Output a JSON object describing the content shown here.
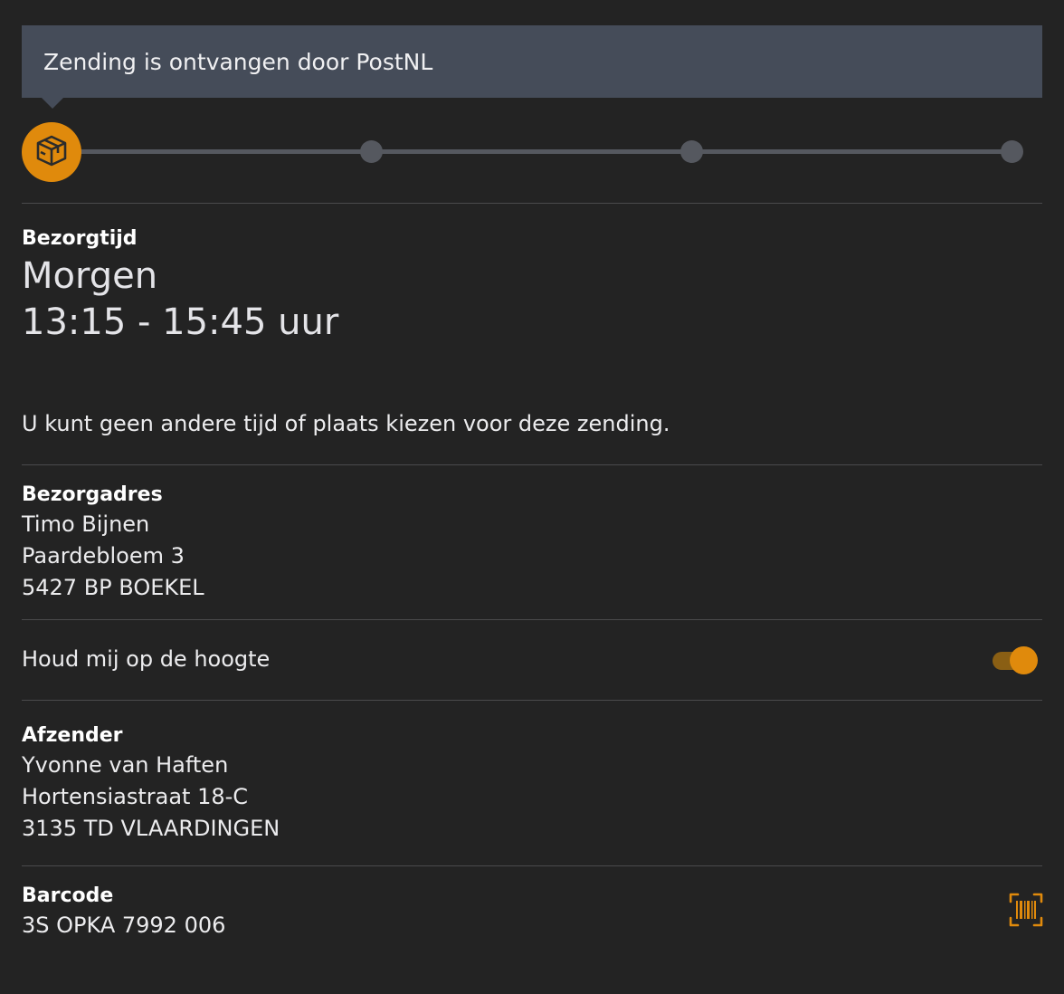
{
  "status": {
    "message": "Zending is ontvangen door PostNL"
  },
  "tracker": {
    "steps_total": 4,
    "current_step": 1,
    "current_icon": "package-icon",
    "accent_color": "#e08a0c"
  },
  "delivery_time": {
    "label": "Bezorgtijd",
    "day": "Morgen",
    "window": "13:15 - 15:45 uur",
    "note": "U kunt geen andere tijd of plaats kiezen voor deze zending."
  },
  "delivery_address": {
    "label": "Bezorgadres",
    "name": "Timo Bijnen",
    "street": "Paardebloem 3",
    "city": "5427 BP BOEKEL"
  },
  "notifications": {
    "label": "Houd mij op de hoogte",
    "enabled": true
  },
  "sender": {
    "label": "Afzender",
    "name": "Yvonne van Haften",
    "street": "Hortensiastraat 18-C",
    "city": "3135 TD VLAARDINGEN"
  },
  "barcode": {
    "label": "Barcode",
    "value": "3S OPKA 7992 006",
    "icon": "barcode-scan-icon"
  }
}
